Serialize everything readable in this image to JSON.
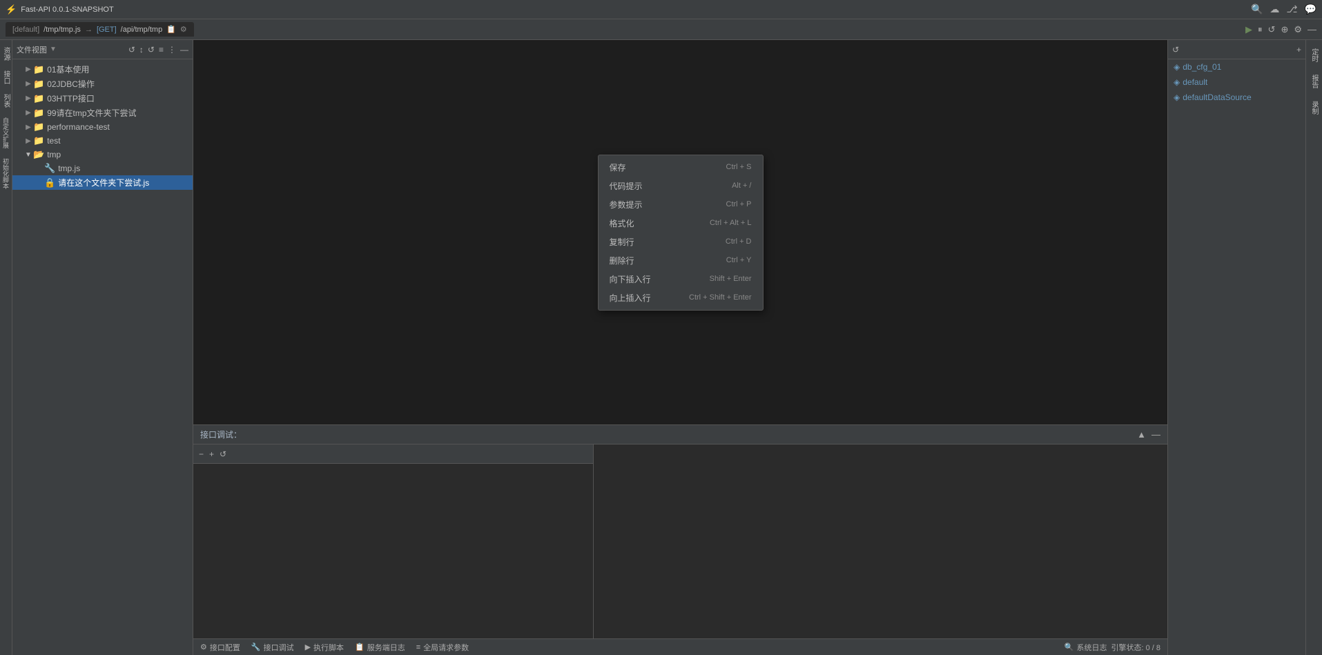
{
  "titleBar": {
    "appName": "Fast-API 0.0.1-SNAPSHOT",
    "icons": [
      "🔍",
      "☁",
      "🐙",
      "💬"
    ]
  },
  "tabBar": {
    "tabs": [
      {
        "label": "[default]  /tmp/tmp.js  →  [GET] /api/tmp/tmp",
        "active": true,
        "icons": [
          "📋",
          "⚙"
        ]
      }
    ],
    "controls": [
      "▶",
      "⏸",
      "↺",
      "⊕",
      "⚙",
      "—"
    ]
  },
  "sidebar": {
    "toolbarLabel": "文件视图",
    "toolbarButtons": [
      "🔄",
      "↕",
      "↺",
      "≡",
      "⋮",
      "—"
    ],
    "tree": [
      {
        "id": "01",
        "label": "01基本使用",
        "type": "folder",
        "level": 1,
        "expanded": false
      },
      {
        "id": "02",
        "label": "02JDBC操作",
        "type": "folder",
        "level": 1,
        "expanded": false
      },
      {
        "id": "03",
        "label": "03HTTP接口",
        "type": "folder",
        "level": 1,
        "expanded": false
      },
      {
        "id": "99",
        "label": "99请在tmp文件夹下尝试",
        "type": "folder",
        "level": 1,
        "expanded": false
      },
      {
        "id": "pt",
        "label": "performance-test",
        "type": "folder",
        "level": 1,
        "expanded": false
      },
      {
        "id": "test",
        "label": "test",
        "type": "folder",
        "level": 1,
        "expanded": false
      },
      {
        "id": "tmp",
        "label": "tmp",
        "type": "folder",
        "level": 1,
        "expanded": true
      },
      {
        "id": "tmp.js",
        "label": "tmp.js",
        "type": "file",
        "level": 2,
        "expanded": false
      },
      {
        "id": "try.js",
        "label": "请在这个文件夹下尝试.js",
        "type": "file-special",
        "level": 2,
        "selected": true
      }
    ]
  },
  "leftToolbar": {
    "items": [
      "资源",
      "接口",
      "列表",
      "自定义扩展",
      "初始化脚本"
    ]
  },
  "editor": {
    "contextMenu": {
      "items": [
        {
          "label": "保存",
          "shortcut": "Ctrl + S"
        },
        {
          "label": "代码提示",
          "shortcut": "Alt + /"
        },
        {
          "label": "参数提示",
          "shortcut": "Ctrl + P"
        },
        {
          "label": "格式化",
          "shortcut": "Ctrl + Alt + L"
        },
        {
          "label": "复制行",
          "shortcut": "Ctrl + D"
        },
        {
          "label": "删除行",
          "shortcut": "Ctrl + Y"
        },
        {
          "label": "向下插入行",
          "shortcut": "Shift + Enter"
        },
        {
          "label": "向上插入行",
          "shortcut": "Ctrl + Shift + Enter"
        }
      ]
    }
  },
  "bottomPanel": {
    "title": "接口调试：",
    "controls": [
      "▲",
      "—"
    ],
    "leftToolbar": {
      "minus": "−",
      "plus": "+",
      "refresh": "↺"
    }
  },
  "rightPanel": {
    "addButton": "+",
    "refreshButton": "↺",
    "items": [
      {
        "label": "db_cfg_01"
      },
      {
        "label": "default"
      },
      {
        "label": "defaultDataSource"
      }
    ]
  },
  "rightToolbar": {
    "items": [
      "定时",
      "报告",
      "录制"
    ]
  },
  "statusBar": {
    "items": [
      {
        "icon": "⚙",
        "label": "接口配置"
      },
      {
        "icon": "🔧",
        "label": "接口调试"
      },
      {
        "icon": "▶",
        "label": "执行脚本"
      },
      {
        "icon": "📋",
        "label": "服务端日志"
      },
      {
        "icon": "≡",
        "label": "全局请求参数"
      }
    ],
    "right": {
      "icon": "🔍",
      "label": "系统日志",
      "status": "引擎状态: 0 / 8"
    }
  }
}
